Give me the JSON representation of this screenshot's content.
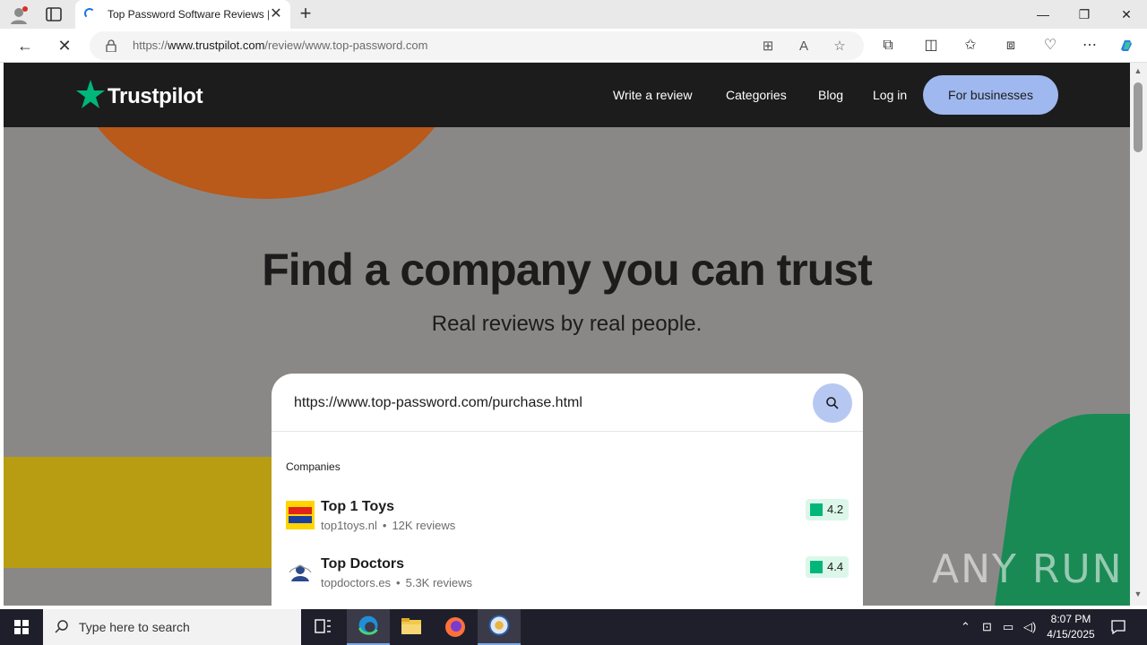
{
  "browser": {
    "tab_title": "Top Password Software Reviews |",
    "url_prefix": "https://",
    "url_host": "www.trustpilot.com",
    "url_path": "/review/www.top-password.com"
  },
  "site": {
    "logo": "Trustpilot",
    "nav": {
      "write_review": "Write a review",
      "categories": "Categories",
      "blog": "Blog",
      "login": "Log in",
      "for_businesses": "For businesses"
    },
    "hero": {
      "title": "Find a company you can trust",
      "subtitle": "Real reviews by real people."
    },
    "search": {
      "query": "https://www.top-password.com/purchase.html",
      "section_label": "Companies",
      "results": [
        {
          "name": "Top 1 Toys",
          "domain": "top1toys.nl",
          "reviews": "12K reviews",
          "rating": "4.2"
        },
        {
          "name": "Top Doctors",
          "domain": "topdoctors.es",
          "reviews": "5.3K reviews",
          "rating": "4.4"
        }
      ]
    }
  },
  "watermark": "ANY RUN",
  "taskbar": {
    "search_placeholder": "Type here to search",
    "time": "8:07 PM",
    "date": "4/15/2025"
  },
  "colors": {
    "brand_green": "#00b67a",
    "header_dark": "#1c1c1c",
    "biz_button": "#9fb8ef",
    "overlay_gray": "#8a8887"
  }
}
